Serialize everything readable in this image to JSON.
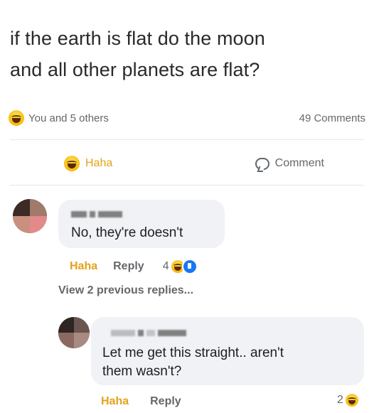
{
  "post": {
    "text_line1": "if the earth is flat do the moon",
    "text_line2": "and all other planets are flat?"
  },
  "reactions": {
    "summary": "You and 5 others",
    "comments_count": "49 Comments"
  },
  "actions": {
    "haha_label": "Haha",
    "comment_label": "Comment"
  },
  "comments": [
    {
      "text": "No, they're doesn't",
      "react_label": "Haha",
      "reply_label": "Reply",
      "reaction_count": "4"
    },
    {
      "text_line1": "Let me get this straight.. aren't",
      "text_line2": "them wasn't?",
      "react_label": "Haha",
      "reply_label": "Reply",
      "reaction_count": "2"
    }
  ],
  "view_previous_replies": "View 2 previous replies...",
  "colors": {
    "haha_accent": "#e3a21a",
    "bubble_bg": "#f0f2f5",
    "muted_text": "#65676b",
    "like_blue": "#1877f2"
  }
}
